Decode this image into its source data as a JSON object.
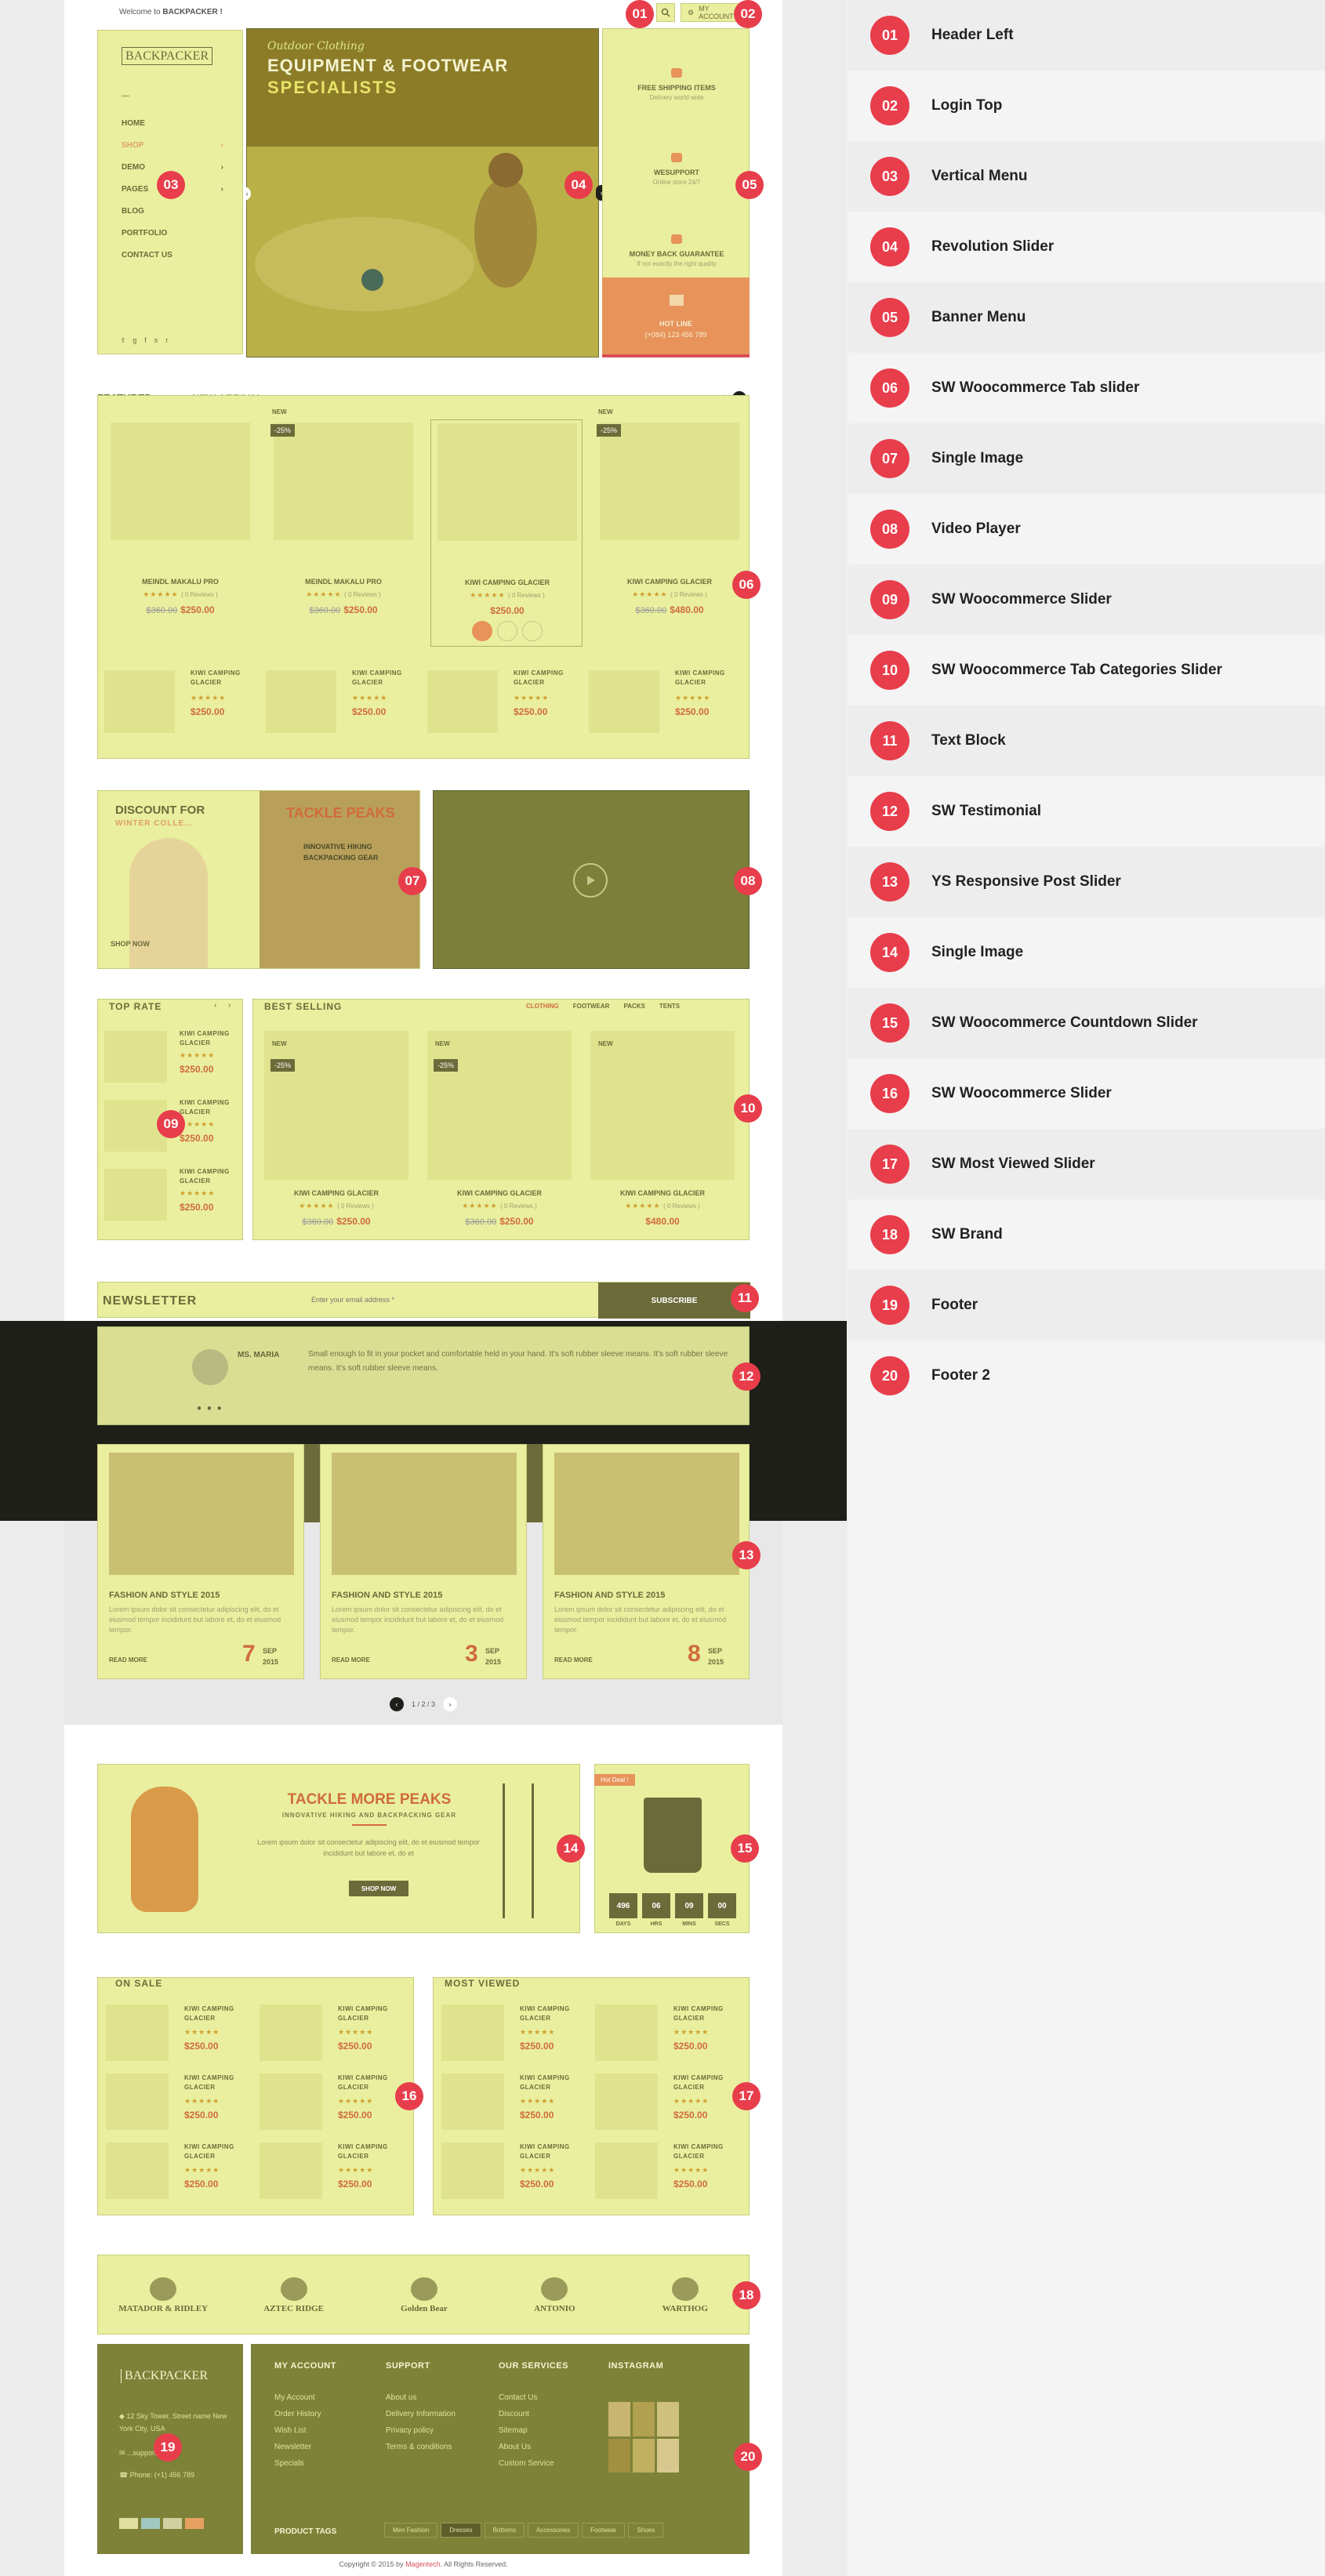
{
  "header": {
    "welcome": "Welcome to",
    "brand": "BACKPACKER !",
    "my_account": "MY ACCOUNT"
  },
  "logo": {
    "text": "BACKPACKER"
  },
  "vertical_menu": [
    {
      "label": "HOME",
      "arrow": ""
    },
    {
      "label": "SHOP",
      "arrow": "›"
    },
    {
      "label": "DEMO",
      "arrow": "›"
    },
    {
      "label": "PAGES",
      "arrow": "›"
    },
    {
      "label": "BLOG",
      "arrow": ""
    },
    {
      "label": "PORTFOLIO",
      "arrow": ""
    },
    {
      "label": "CONTACT US",
      "arrow": ""
    }
  ],
  "slider": {
    "tagline": "Outdoor Clothing",
    "title": "EQUIPMENT & FOOTWEAR",
    "subtitle": "SPECIALISTS"
  },
  "banner_menu": [
    {
      "title": "FREE SHIPPING ITEMS",
      "sub": "Delivery world wide"
    },
    {
      "title": "WESUPPORT",
      "sub": "Online store 24/7"
    },
    {
      "title": "MONEY BACK GUARANTEE",
      "sub": "If not exactly the right quality"
    },
    {
      "title": "HOT LINE",
      "sub": "(+084) 123 456 789"
    }
  ],
  "featured": {
    "tab_featured": "FEATURED",
    "tab_new": "NEW ARRIVAL",
    "products": [
      {
        "name": "MEINDL MAKALU PRO",
        "reviews": "( 0 Reviews )",
        "old": "$360.00",
        "price": "$250.00",
        "badge": "",
        "sale": ""
      },
      {
        "name": "MEINDL MAKALU PRO",
        "reviews": "( 0 Reviews )",
        "old": "$360.00",
        "price": "$250.00",
        "badge": "NEW",
        "sale": "-25%"
      },
      {
        "name": "KIWI CAMPING GLACIER",
        "reviews": "( 0 Reviews )",
        "old": "",
        "price": "$250.00",
        "badge": "",
        "sale": ""
      },
      {
        "name": "KIWI CAMPING GLACIER",
        "reviews": "( 0 Reviews )",
        "old": "$360.00",
        "price": "$480.00",
        "badge": "NEW",
        "sale": "-25%"
      }
    ],
    "small": [
      {
        "name": "KIWI CAMPING GLACIER",
        "price": "$250.00"
      },
      {
        "name": "KIWI CAMPING GLACIER",
        "price": "$250.00"
      },
      {
        "name": "KIWI CAMPING GLACIER",
        "price": "$250.00"
      },
      {
        "name": "KIWI CAMPING GLACIER",
        "price": "$250.00"
      }
    ]
  },
  "promo": {
    "discount_title": "DISCOUNT FOR",
    "discount_sub": "WINTER COLLE...",
    "shop_now": "SHOP NOW",
    "tackle_title": "TACKLE PEAKS",
    "tackle_line1": "INNOVATIVE HIKING",
    "tackle_line2": "BACKPACKING GEAR"
  },
  "top_rate": {
    "title": "TOP RATE",
    "items": [
      {
        "name": "KIWI CAMPING GLACIER",
        "price": "$250.00"
      },
      {
        "name": "KIWI CAMPING GLACIER",
        "price": "$250.00"
      },
      {
        "name": "KIWI CAMPING GLACIER",
        "price": "$250.00"
      }
    ]
  },
  "best_selling": {
    "title": "BEST SELLING",
    "tabs": [
      "CLOTHING",
      "FOOTWEAR",
      "PACKS",
      "TENTS"
    ],
    "products": [
      {
        "name": "KIWI CAMPING GLACIER",
        "reviews": "( 0 Reviews )",
        "old": "$360.00",
        "price": "$250.00",
        "badge": "NEW",
        "sale": "-25%"
      },
      {
        "name": "KIWI CAMPING GLACIER",
        "reviews": "( 0 Reviews )",
        "old": "$360.00",
        "price": "$250.00",
        "badge": "NEW",
        "sale": "-25%"
      },
      {
        "name": "KIWI CAMPING GLACIER",
        "reviews": "( 0 Reviews )",
        "old": "",
        "price": "$480.00",
        "badge": "NEW",
        "sale": ""
      }
    ]
  },
  "newsletter": {
    "title": "NEWSLETTER",
    "placeholder": "Enter your email address *",
    "subscribe": "SUBSCRIBE"
  },
  "testimonial": {
    "author": "MS. MARIA",
    "text": "Small enough to fit in your pocket and comfortable held in your hand. It's soft rubber sleeve means. It's soft rubber sleeve means. It's soft rubber sleeve means."
  },
  "posts": [
    {
      "title": "FASHION AND STYLE 2015",
      "excerpt": "Lorem ipsum dolor sit consectetur adipiscing elit, do et eiusmod tempor incididunt but labore et, do et eiusmod tempor.",
      "read_more": "READ MORE",
      "day": "7",
      "month": "SEP",
      "year": "2015"
    },
    {
      "title": "FASHION AND STYLE 2015",
      "excerpt": "Lorem ipsum dolor sit consectetur adipiscing elit, do et eiusmod tempor incididunt but labore et, do et eiusmod tempor.",
      "read_more": "READ MORE",
      "day": "3",
      "month": "SEP",
      "year": "2015"
    },
    {
      "title": "FASHION AND STYLE 2015",
      "excerpt": "Lorem ipsum dolor sit consectetur adipiscing elit, do et eiusmod tempor incididunt but labore et, do et eiusmod tempor.",
      "read_more": "READ MORE",
      "day": "8",
      "month": "SEP",
      "year": "2015"
    }
  ],
  "pager": {
    "text": "1 / 2 / 3"
  },
  "tackle_more": {
    "title": "TACKLE MORE PEAKS",
    "sub": "INNOVATIVE HIKING AND BACKPACKING GEAR",
    "text": "Lorem ipsum dolor sit consectetur adipiscing elit, do et eiusmod tempor incididunt but labore et, do et",
    "button": "SHOP NOW"
  },
  "countdown": {
    "label": "Hot Deal !",
    "units": [
      {
        "value": "496",
        "label": "DAYS"
      },
      {
        "value": "06",
        "label": "HRS"
      },
      {
        "value": "09",
        "label": "MINS"
      },
      {
        "value": "00",
        "label": "SECS"
      }
    ]
  },
  "on_sale": {
    "title": "ON SALE",
    "items": [
      {
        "name": "KIWI CAMPING GLACIER",
        "price": "$250.00"
      },
      {
        "name": "KIWI CAMPING GLACIER",
        "price": "$250.00"
      },
      {
        "name": "KIWI CAMPING GLACIER",
        "price": "$250.00"
      },
      {
        "name": "KIWI CAMPING GLACIER",
        "price": "$250.00"
      },
      {
        "name": "KIWI CAMPING GLACIER",
        "price": "$250.00"
      },
      {
        "name": "KIWI CAMPING GLACIER",
        "price": "$250.00"
      }
    ]
  },
  "most_viewed": {
    "title": "MOST VIEWED",
    "items": [
      {
        "name": "KIWI CAMPING GLACIER",
        "price": "$250.00"
      },
      {
        "name": "KIWI CAMPING GLACIER",
        "price": "$250.00"
      },
      {
        "name": "KIWI CAMPING GLACIER",
        "price": "$250.00"
      },
      {
        "name": "KIWI CAMPING GLACIER",
        "price": "$250.00"
      },
      {
        "name": "KIWI CAMPING GLACIER",
        "price": "$250.00"
      },
      {
        "name": "KIWI CAMPING GLACIER",
        "price": "$250.00"
      }
    ]
  },
  "brands": [
    "MATADOR & RIDLEY",
    "AZTEC RIDGE",
    "Golden Bear",
    "ANTONIO",
    "WARTHOG"
  ],
  "footer": {
    "logo": "BACKPACKER",
    "address": "12 Sky Tower, Street name New York City, USA",
    "email": "...support.com",
    "phone": "Phone: (+1) 456 789",
    "cols": [
      {
        "title": "MY ACCOUNT",
        "links": [
          "My Account",
          "Order History",
          "Wish List",
          "Newsletter",
          "Specials"
        ]
      },
      {
        "title": "SUPPORT",
        "links": [
          "About us",
          "Delivery Information",
          "Privacy policy",
          "Terms & conditions"
        ]
      },
      {
        "title": "OUR SERVICES",
        "links": [
          "Contact Us",
          "Discount",
          "Sitemap",
          "About Us",
          "Custom Service"
        ]
      },
      {
        "title": "INSTAGRAM",
        "links": []
      }
    ],
    "product_tags_label": "PRODUCT TAGS",
    "tags": [
      "Men Fashion",
      "Dresses",
      "Bottoms",
      "Accessories",
      "Footwear",
      "Shoes"
    ],
    "copyright_prefix": "Copyright © 2015 by",
    "copyright_brand": "Magentech",
    "copyright_suffix": ". All Rights Reserved."
  },
  "legend": [
    {
      "num": "01",
      "label": "Header Left"
    },
    {
      "num": "02",
      "label": "Login Top"
    },
    {
      "num": "03",
      "label": "Vertical Menu"
    },
    {
      "num": "04",
      "label": "Revolution Slider"
    },
    {
      "num": "05",
      "label": "Banner Menu"
    },
    {
      "num": "06",
      "label": "SW Woocommerce Tab slider"
    },
    {
      "num": "07",
      "label": "Single Image"
    },
    {
      "num": "08",
      "label": "Video Player"
    },
    {
      "num": "09",
      "label": "SW Woocommerce Slider"
    },
    {
      "num": "10",
      "label": "SW Woocommerce Tab Categories Slider"
    },
    {
      "num": "11",
      "label": "Text Block"
    },
    {
      "num": "12",
      "label": "SW Testimonial"
    },
    {
      "num": "13",
      "label": "YS Responsive Post Slider"
    },
    {
      "num": "14",
      "label": "Single Image"
    },
    {
      "num": "15",
      "label": "SW Woocommerce Countdown Slider"
    },
    {
      "num": "16",
      "label": "SW Woocommerce Slider"
    },
    {
      "num": "17",
      "label": "SW Most Viewed Slider"
    },
    {
      "num": "18",
      "label": "SW Brand"
    },
    {
      "num": "19",
      "label": "Footer"
    },
    {
      "num": "20",
      "label": "Footer 2"
    }
  ],
  "markers": [
    "01",
    "02",
    "03",
    "04",
    "05",
    "06",
    "07",
    "08",
    "09",
    "10",
    "11",
    "12",
    "13",
    "14",
    "15",
    "16",
    "17",
    "18",
    "19",
    "20"
  ]
}
